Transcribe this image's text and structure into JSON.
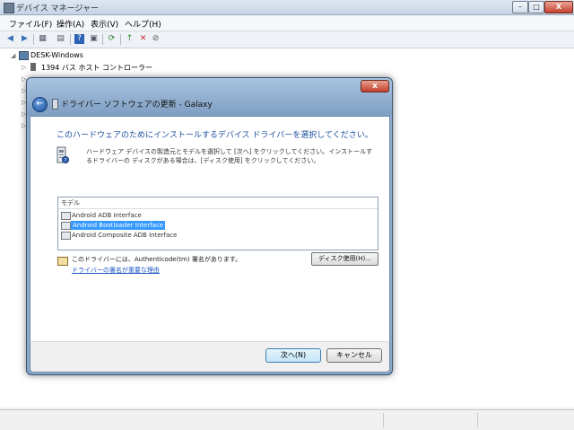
{
  "window": {
    "title": "デバイス マネージャー",
    "controls": {
      "minimize": "–",
      "maximize": "□",
      "close": "X"
    }
  },
  "menu": [
    "ファイル(F)",
    "操作(A)",
    "表示(V)",
    "ヘルプ(H)"
  ],
  "toolbar": {
    "back": "◀",
    "forward": "▶",
    "view1": "▦",
    "view2": "▤",
    "help": "?",
    "view3": "▣",
    "scan": "⟳",
    "update": "↑",
    "uninstall": "✕",
    "disable": "⊘"
  },
  "tree": {
    "root": "DESK-Windows",
    "items": [
      "1394 バス ホスト コントローラー"
    ]
  },
  "dialog": {
    "close": "x",
    "back_glyph": "←",
    "title": "ドライバー ソフトウェアの更新 - Galaxy",
    "heading": "このハードウェアのためにインストールするデバイス ドライバーを選択してください。",
    "description": "ハードウェア デバイスの製造元とモデルを選択して [次へ] をクリックしてください。インストールするドライバーの ディスクがある場合は、[ディスク使用] をクリックしてください。",
    "list_header": "モデル",
    "models": [
      {
        "label": "Android ADB Interface",
        "selected": false
      },
      {
        "label": "Android Bootloader Interface",
        "selected": true
      },
      {
        "label": "Android Composite ADB Interface",
        "selected": false
      }
    ],
    "signature_text": "このドライバーには、Authenticode(tm) 署名があります。",
    "signature_link": "ドライバーの署名が重要な理由",
    "disk_button": "ディスク使用(H)...",
    "next_button": "次へ(N)",
    "cancel_button": "キャンセル"
  }
}
